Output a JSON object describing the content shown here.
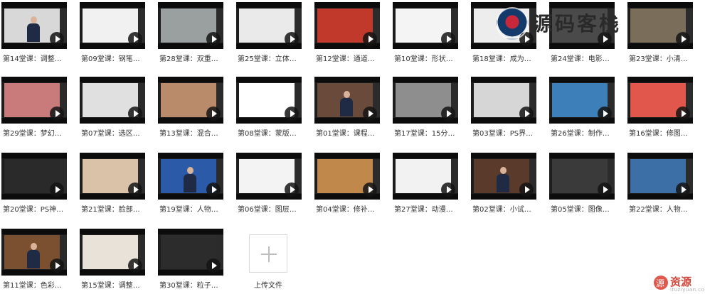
{
  "tiles": [
    {
      "label": "第14堂课：调整…",
      "theme": "#d8d8d8",
      "person": true
    },
    {
      "label": "第09堂课：钢笔…",
      "theme": "#f1f1f1",
      "person": false
    },
    {
      "label": "第28堂课：双重…",
      "theme": "#9aa0a0",
      "person": false
    },
    {
      "label": "第25堂课：立体…",
      "theme": "#eaeaea",
      "person": false
    },
    {
      "label": "第12堂课：通道…",
      "theme": "#c0392b",
      "person": false
    },
    {
      "label": "第10堂课：形状…",
      "theme": "#f4f4f4",
      "person": false
    },
    {
      "label": "第18堂课：成为…",
      "theme": "#ededed",
      "person": false
    },
    {
      "label": "第24堂课：电影…",
      "theme": "#4a4a4a",
      "person": false
    },
    {
      "label": "第23堂课：小清…",
      "theme": "#7a6e5a",
      "person": false
    },
    {
      "label": "第29堂课：梦幻…",
      "theme": "#c97a7a",
      "person": false
    },
    {
      "label": "第07堂课：选区…",
      "theme": "#e0e0e0",
      "person": false
    },
    {
      "label": "第13堂课：混合…",
      "theme": "#b98b6a",
      "person": false
    },
    {
      "label": "第08堂课：蒙版…",
      "theme": "#ffffff",
      "person": false
    },
    {
      "label": "第01堂课：课程…",
      "theme": "#6a4a3a",
      "person": true
    },
    {
      "label": "第17堂课：15分…",
      "theme": "#8e8e8e",
      "person": false
    },
    {
      "label": "第03堂课：PS界…",
      "theme": "#d6d6d6",
      "person": false
    },
    {
      "label": "第26堂课：制作…",
      "theme": "#3d7fb8",
      "person": false
    },
    {
      "label": "第16堂课：修图…",
      "theme": "#e2574c",
      "person": false
    },
    {
      "label": "第20堂课：PS神…",
      "theme": "#2a2a2a",
      "person": false
    },
    {
      "label": "第21堂课：脸部…",
      "theme": "#d9c2a8",
      "person": false
    },
    {
      "label": "第19堂课：人物…",
      "theme": "#2b5ba8",
      "person": true
    },
    {
      "label": "第06堂课：图层…",
      "theme": "#f3f3f3",
      "person": false
    },
    {
      "label": "第04堂课：修补…",
      "theme": "#c0884a",
      "person": false
    },
    {
      "label": "第27堂课：动漫…",
      "theme": "#f2f2f2",
      "person": false
    },
    {
      "label": "第02堂课：小试…",
      "theme": "#5a3a2a",
      "person": true
    },
    {
      "label": "第05堂课：图像…",
      "theme": "#3a3a3a",
      "person": false
    },
    {
      "label": "第22堂课：人物…",
      "theme": "#3b6fa5",
      "person": false
    },
    {
      "label": "第11堂课：色彩…",
      "theme": "#7a5030",
      "person": true
    },
    {
      "label": "第15堂课：调整…",
      "theme": "#e8e2d8",
      "person": false
    },
    {
      "label": "第30堂课：粒子…",
      "theme": "#2c2c2c",
      "person": false
    }
  ],
  "upload": {
    "label": "上传文件"
  },
  "watermark_top": {
    "text": "源码客栈"
  },
  "watermark_bottom": {
    "brand": "资源",
    "sub": "ituziyuan.com"
  }
}
